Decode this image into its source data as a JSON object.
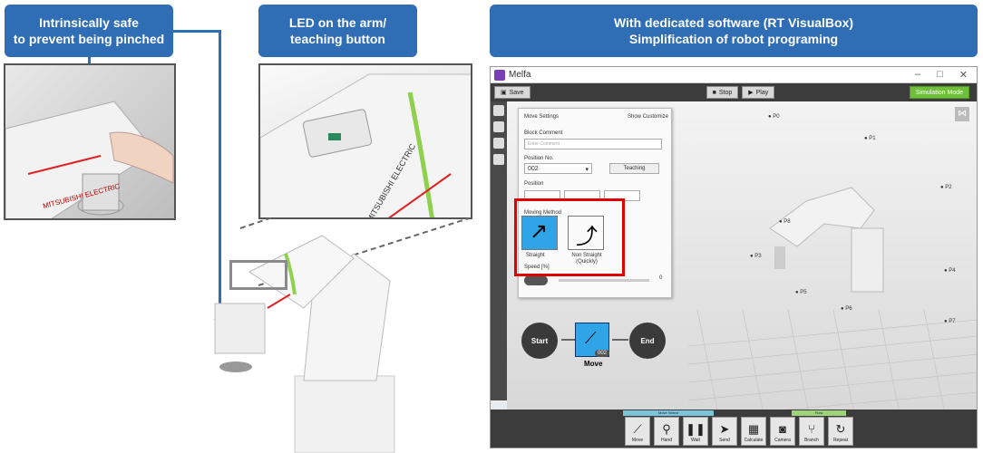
{
  "callouts": {
    "safety": [
      "Intrinsically safe",
      "to prevent being pinched"
    ],
    "led": [
      "LED on the arm/",
      "teaching button"
    ],
    "software": [
      "With dedicated software (RT VisualBox)",
      "Simplification of robot programing"
    ]
  },
  "robot_brand": "MITSUBISHI ELECTRIC",
  "window": {
    "title": "Melfa",
    "toolbar": {
      "save": "Save",
      "stop": "Stop",
      "play": "Play",
      "simulation": "Simulation Mode"
    },
    "panel": {
      "header": "Move Settings",
      "header_right": "Show Customize",
      "block_comment_label": "Block Comment",
      "block_comment_placeholder": "Enter Comment",
      "position_no_label": "Position No.",
      "position_no_value": "002",
      "teaching": "Teaching",
      "position_label": "Position",
      "moving_method_label": "Moving Method",
      "straight": "Straight",
      "non_straight": "Non Straight (Quickly)",
      "speed_label": "Speed [%]",
      "speed_value": "0"
    },
    "flow": {
      "start": "Start",
      "move": "Move",
      "move_badge": "002",
      "end": "End"
    },
    "bottom": {
      "group1": "Move Select",
      "group2": "Flow",
      "items": [
        "Move",
        "Hand",
        "Wait",
        "Send",
        "Calculate",
        "Camera",
        "Branch",
        "Repeat"
      ]
    },
    "points": [
      "P0",
      "P1",
      "P2",
      "P3",
      "P4",
      "P5",
      "P6",
      "P7",
      "P8"
    ]
  }
}
